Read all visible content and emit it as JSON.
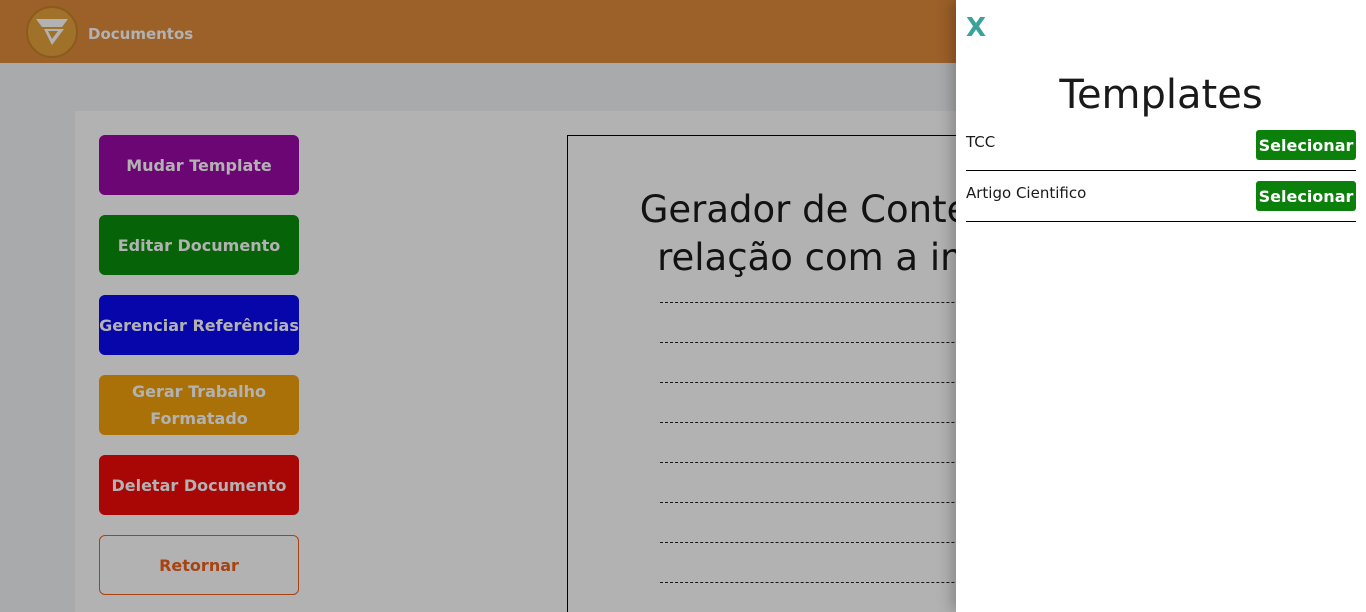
{
  "header": {
    "title": "Documentos",
    "logo_icon": "logo-icon"
  },
  "actions": {
    "change_template": "Mudar Template",
    "edit_document": "Editar Documento",
    "manage_references": "Gerenciar Referências",
    "generate_formatted": "Gerar Trabalho Formatado",
    "delete_document": "Deletar Documento",
    "return": "Retornar"
  },
  "document": {
    "title": "Gerador de Conteúd\nrelação com a ime"
  },
  "panel": {
    "close_label": "X",
    "title": "Templates",
    "templates": [
      {
        "name": "TCC",
        "action": "Selecionar"
      },
      {
        "name": "Artigo Cientifico",
        "action": "Selecionar"
      }
    ]
  },
  "colors": {
    "header": "#e08a3c",
    "purple": "#9a0aa6",
    "green": "#0b8f0b",
    "blue": "#0a0af5",
    "orange": "#f4a30c",
    "red": "#f30a0a",
    "return_border": "#f0601a",
    "close": "#3aa29a",
    "select": "#0b800b"
  }
}
